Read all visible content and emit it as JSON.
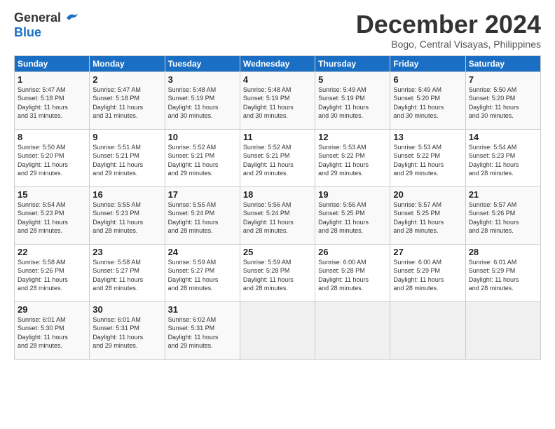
{
  "header": {
    "logo_general": "General",
    "logo_blue": "Blue",
    "month_title": "December 2024",
    "subtitle": "Bogo, Central Visayas, Philippines"
  },
  "columns": [
    "Sunday",
    "Monday",
    "Tuesday",
    "Wednesday",
    "Thursday",
    "Friday",
    "Saturday"
  ],
  "weeks": [
    [
      {
        "day": "1",
        "info": "Sunrise: 5:47 AM\nSunset: 5:18 PM\nDaylight: 11 hours\nand 31 minutes."
      },
      {
        "day": "2",
        "info": "Sunrise: 5:47 AM\nSunset: 5:18 PM\nDaylight: 11 hours\nand 31 minutes."
      },
      {
        "day": "3",
        "info": "Sunrise: 5:48 AM\nSunset: 5:19 PM\nDaylight: 11 hours\nand 30 minutes."
      },
      {
        "day": "4",
        "info": "Sunrise: 5:48 AM\nSunset: 5:19 PM\nDaylight: 11 hours\nand 30 minutes."
      },
      {
        "day": "5",
        "info": "Sunrise: 5:49 AM\nSunset: 5:19 PM\nDaylight: 11 hours\nand 30 minutes."
      },
      {
        "day": "6",
        "info": "Sunrise: 5:49 AM\nSunset: 5:20 PM\nDaylight: 11 hours\nand 30 minutes."
      },
      {
        "day": "7",
        "info": "Sunrise: 5:50 AM\nSunset: 5:20 PM\nDaylight: 11 hours\nand 30 minutes."
      }
    ],
    [
      {
        "day": "8",
        "info": "Sunrise: 5:50 AM\nSunset: 5:20 PM\nDaylight: 11 hours\nand 29 minutes."
      },
      {
        "day": "9",
        "info": "Sunrise: 5:51 AM\nSunset: 5:21 PM\nDaylight: 11 hours\nand 29 minutes."
      },
      {
        "day": "10",
        "info": "Sunrise: 5:52 AM\nSunset: 5:21 PM\nDaylight: 11 hours\nand 29 minutes."
      },
      {
        "day": "11",
        "info": "Sunrise: 5:52 AM\nSunset: 5:21 PM\nDaylight: 11 hours\nand 29 minutes."
      },
      {
        "day": "12",
        "info": "Sunrise: 5:53 AM\nSunset: 5:22 PM\nDaylight: 11 hours\nand 29 minutes."
      },
      {
        "day": "13",
        "info": "Sunrise: 5:53 AM\nSunset: 5:22 PM\nDaylight: 11 hours\nand 29 minutes."
      },
      {
        "day": "14",
        "info": "Sunrise: 5:54 AM\nSunset: 5:23 PM\nDaylight: 11 hours\nand 28 minutes."
      }
    ],
    [
      {
        "day": "15",
        "info": "Sunrise: 5:54 AM\nSunset: 5:23 PM\nDaylight: 11 hours\nand 28 minutes."
      },
      {
        "day": "16",
        "info": "Sunrise: 5:55 AM\nSunset: 5:23 PM\nDaylight: 11 hours\nand 28 minutes."
      },
      {
        "day": "17",
        "info": "Sunrise: 5:55 AM\nSunset: 5:24 PM\nDaylight: 11 hours\nand 28 minutes."
      },
      {
        "day": "18",
        "info": "Sunrise: 5:56 AM\nSunset: 5:24 PM\nDaylight: 11 hours\nand 28 minutes."
      },
      {
        "day": "19",
        "info": "Sunrise: 5:56 AM\nSunset: 5:25 PM\nDaylight: 11 hours\nand 28 minutes."
      },
      {
        "day": "20",
        "info": "Sunrise: 5:57 AM\nSunset: 5:25 PM\nDaylight: 11 hours\nand 28 minutes."
      },
      {
        "day": "21",
        "info": "Sunrise: 5:57 AM\nSunset: 5:26 PM\nDaylight: 11 hours\nand 28 minutes."
      }
    ],
    [
      {
        "day": "22",
        "info": "Sunrise: 5:58 AM\nSunset: 5:26 PM\nDaylight: 11 hours\nand 28 minutes."
      },
      {
        "day": "23",
        "info": "Sunrise: 5:58 AM\nSunset: 5:27 PM\nDaylight: 11 hours\nand 28 minutes."
      },
      {
        "day": "24",
        "info": "Sunrise: 5:59 AM\nSunset: 5:27 PM\nDaylight: 11 hours\nand 28 minutes."
      },
      {
        "day": "25",
        "info": "Sunrise: 5:59 AM\nSunset: 5:28 PM\nDaylight: 11 hours\nand 28 minutes."
      },
      {
        "day": "26",
        "info": "Sunrise: 6:00 AM\nSunset: 5:28 PM\nDaylight: 11 hours\nand 28 minutes."
      },
      {
        "day": "27",
        "info": "Sunrise: 6:00 AM\nSunset: 5:29 PM\nDaylight: 11 hours\nand 28 minutes."
      },
      {
        "day": "28",
        "info": "Sunrise: 6:01 AM\nSunset: 5:29 PM\nDaylight: 11 hours\nand 28 minutes."
      }
    ],
    [
      {
        "day": "29",
        "info": "Sunrise: 6:01 AM\nSunset: 5:30 PM\nDaylight: 11 hours\nand 28 minutes."
      },
      {
        "day": "30",
        "info": "Sunrise: 6:01 AM\nSunset: 5:31 PM\nDaylight: 11 hours\nand 29 minutes."
      },
      {
        "day": "31",
        "info": "Sunrise: 6:02 AM\nSunset: 5:31 PM\nDaylight: 11 hours\nand 29 minutes."
      },
      {
        "day": "",
        "info": ""
      },
      {
        "day": "",
        "info": ""
      },
      {
        "day": "",
        "info": ""
      },
      {
        "day": "",
        "info": ""
      }
    ]
  ]
}
